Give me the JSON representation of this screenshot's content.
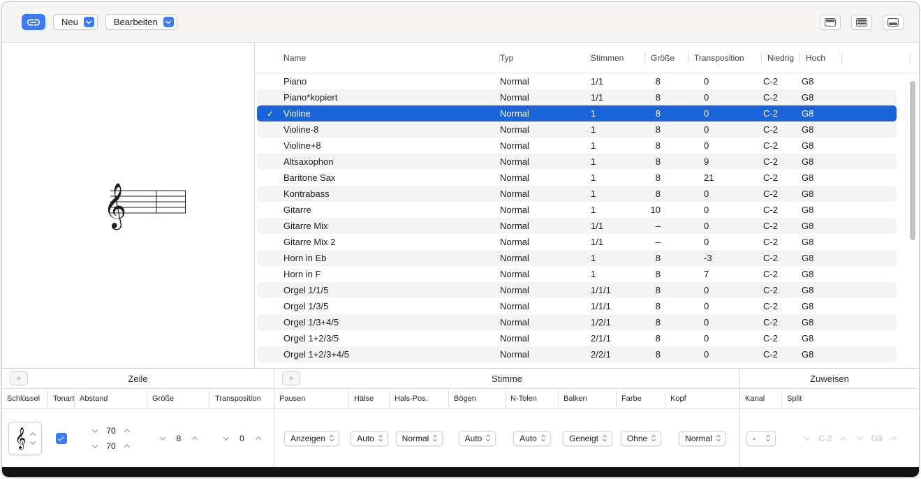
{
  "toolbar": {
    "link_button": {
      "icon": "link-icon"
    },
    "neu": {
      "label": "Neu"
    },
    "bearbeiten": {
      "label": "Bearbeiten"
    },
    "view_buttons": [
      {
        "icon": "layout-top-pane-icon"
      },
      {
        "icon": "layout-rows-icon"
      },
      {
        "icon": "layout-bottom-pane-icon"
      }
    ]
  },
  "preview": {
    "clef_glyph": "𝄞"
  },
  "table": {
    "columns": {
      "name": "Name",
      "typ": "Typ",
      "stimmen": "Stimmen",
      "groesse": "Größe",
      "transposition": "Transposition",
      "niedrig": "Niedrig",
      "hoch": "Hoch"
    },
    "check_glyph": "✓",
    "rows": [
      {
        "name": "Piano",
        "typ": "Normal",
        "stimmen": "1/1",
        "groesse": "8",
        "transposition": "0",
        "niedrig": "C-2",
        "hoch": "G8",
        "selected": false,
        "checked": false
      },
      {
        "name": "Piano*kopiert",
        "typ": "Normal",
        "stimmen": "1/1",
        "groesse": "8",
        "transposition": "0",
        "niedrig": "C-2",
        "hoch": "G8",
        "selected": false,
        "checked": false
      },
      {
        "name": "Violine",
        "typ": "Normal",
        "stimmen": "1",
        "groesse": "8",
        "transposition": "0",
        "niedrig": "C-2",
        "hoch": "G8",
        "selected": true,
        "checked": true
      },
      {
        "name": "Violine-8",
        "typ": "Normal",
        "stimmen": "1",
        "groesse": "8",
        "transposition": "0",
        "niedrig": "C-2",
        "hoch": "G8",
        "selected": false,
        "checked": false
      },
      {
        "name": "Violine+8",
        "typ": "Normal",
        "stimmen": "1",
        "groesse": "8",
        "transposition": "0",
        "niedrig": "C-2",
        "hoch": "G8",
        "selected": false,
        "checked": false
      },
      {
        "name": "Altsaxophon",
        "typ": "Normal",
        "stimmen": "1",
        "groesse": "8",
        "transposition": "9",
        "niedrig": "C-2",
        "hoch": "G8",
        "selected": false,
        "checked": false
      },
      {
        "name": "Baritone Sax",
        "typ": "Normal",
        "stimmen": "1",
        "groesse": "8",
        "transposition": "21",
        "niedrig": "C-2",
        "hoch": "G8",
        "selected": false,
        "checked": false
      },
      {
        "name": "Kontrabass",
        "typ": "Normal",
        "stimmen": "1",
        "groesse": "8",
        "transposition": "0",
        "niedrig": "C-2",
        "hoch": "G8",
        "selected": false,
        "checked": false
      },
      {
        "name": "Gitarre",
        "typ": "Normal",
        "stimmen": "1",
        "groesse": "10",
        "transposition": "0",
        "niedrig": "C-2",
        "hoch": "G8",
        "selected": false,
        "checked": false
      },
      {
        "name": "Gitarre Mix",
        "typ": "Normal",
        "stimmen": "1/1",
        "groesse": "–",
        "transposition": "0",
        "niedrig": "C-2",
        "hoch": "G8",
        "selected": false,
        "checked": false
      },
      {
        "name": "Gitarre Mix 2",
        "typ": "Normal",
        "stimmen": "1/1",
        "groesse": "–",
        "transposition": "0",
        "niedrig": "C-2",
        "hoch": "G8",
        "selected": false,
        "checked": false
      },
      {
        "name": "Horn in Eb",
        "typ": "Normal",
        "stimmen": "1",
        "groesse": "8",
        "transposition": "-3",
        "niedrig": "C-2",
        "hoch": "G8",
        "selected": false,
        "checked": false
      },
      {
        "name": "Horn in F",
        "typ": "Normal",
        "stimmen": "1",
        "groesse": "8",
        "transposition": "7",
        "niedrig": "C-2",
        "hoch": "G8",
        "selected": false,
        "checked": false
      },
      {
        "name": "Orgel 1/1/5",
        "typ": "Normal",
        "stimmen": "1/1/1",
        "groesse": "8",
        "transposition": "0",
        "niedrig": "C-2",
        "hoch": "G8",
        "selected": false,
        "checked": false
      },
      {
        "name": "Orgel 1/3/5",
        "typ": "Normal",
        "stimmen": "1/1/1",
        "groesse": "8",
        "transposition": "0",
        "niedrig": "C-2",
        "hoch": "G8",
        "selected": false,
        "checked": false
      },
      {
        "name": "Orgel 1/3+4/5",
        "typ": "Normal",
        "stimmen": "1/2/1",
        "groesse": "8",
        "transposition": "0",
        "niedrig": "C-2",
        "hoch": "G8",
        "selected": false,
        "checked": false
      },
      {
        "name": "Orgel 1+2/3/5",
        "typ": "Normal",
        "stimmen": "2/1/1",
        "groesse": "8",
        "transposition": "0",
        "niedrig": "C-2",
        "hoch": "G8",
        "selected": false,
        "checked": false
      },
      {
        "name": "Orgel 1+2/3+4/5",
        "typ": "Normal",
        "stimmen": "2/2/1",
        "groesse": "8",
        "transposition": "0",
        "niedrig": "C-2",
        "hoch": "G8",
        "selected": false,
        "checked": false
      }
    ]
  },
  "bottom": {
    "zeile": {
      "title": "Zeile",
      "add_label": "+",
      "labels": {
        "schluessel": "Schlüssel",
        "tonart": "Tonart",
        "abstand": "Abstand",
        "groesse": "Größe",
        "transposition": "Transposition"
      },
      "controls": {
        "clef_glyph": "𝄞",
        "abstand_top": "70",
        "abstand_bottom": "70",
        "groesse": "8",
        "transposition": "0"
      }
    },
    "stimme": {
      "title": "Stimme",
      "add_label": "+",
      "labels": {
        "pausen": "Pausen",
        "haelse": "Hälse",
        "hals_pos": "Hals-Pos.",
        "boegen": "Bögen",
        "n_tolen": "N-Tolen",
        "balken": "Balken",
        "farbe": "Farbe",
        "kopf": "Kopf"
      },
      "controls": {
        "pausen": "Anzeigen",
        "haelse": "Auto",
        "hals_pos": "Normal",
        "boegen": "Auto",
        "n_tolen": "Auto",
        "balken": "Geneigt",
        "farbe": "Ohne",
        "kopf": "Normal"
      }
    },
    "zuweisen": {
      "title": "Zuweisen",
      "labels": {
        "kanal": "Kanal",
        "split": "Split"
      },
      "controls": {
        "kanal": "-",
        "split_low": "C-2",
        "split_high": "G8"
      }
    }
  },
  "colors": {
    "accent": "#3b7cf5",
    "selection": "#1a63d9"
  }
}
